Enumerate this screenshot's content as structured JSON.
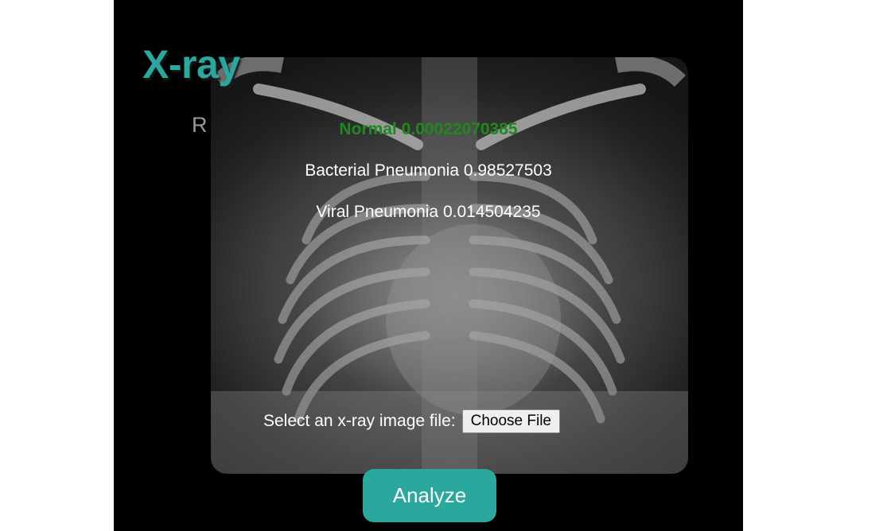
{
  "app": {
    "title": "X-ray"
  },
  "image": {
    "marker": "R",
    "alt": "chest x-ray"
  },
  "results": {
    "normal": "Normal 0.00022070385",
    "bacterial": "Bacterial Pneumonia 0.98527503",
    "viral": "Viral Pneumonia 0.014504235"
  },
  "upload": {
    "label": "Select an x-ray image file:",
    "button_label": "Choose File"
  },
  "actions": {
    "analyze_label": "Analyze"
  },
  "colors": {
    "accent": "#2aa89e",
    "normal_text": "#1e8a1e",
    "background": "#000000"
  }
}
